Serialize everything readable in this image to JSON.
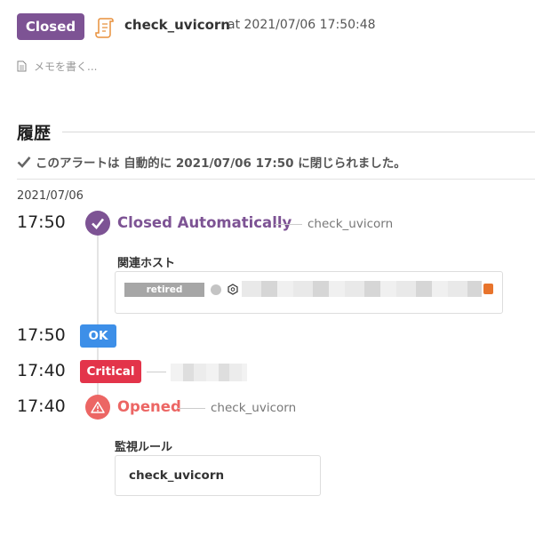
{
  "header": {
    "status": "Closed",
    "status_color": "#7d5394",
    "monitor_icon": "scroll-icon",
    "monitor_name": "check_uvicorn",
    "at_text": "at 2021/07/06 17:50:48"
  },
  "memo": {
    "icon": "document-icon",
    "placeholder": "メモを書く..."
  },
  "history": {
    "title": "履歴",
    "auto_closed_note": "このアラートは 自動的に 2021/07/06 17:50 に閉じられました。",
    "date": "2021/07/06",
    "events": [
      {
        "time": "17:50",
        "label": "Closed Automatically",
        "monitor": "check_uvicorn",
        "color": "#7d5394",
        "related_hosts_label": "関連ホスト",
        "host": {
          "tag": "retired",
          "status_color": "#c4c4c4"
        }
      },
      {
        "time": "17:50",
        "status": "OK",
        "color": "#3d8fe8"
      },
      {
        "time": "17:40",
        "status": "Critical",
        "color": "#e3344a"
      },
      {
        "time": "17:40",
        "label": "Opened",
        "monitor": "check_uvicorn",
        "color": "#ec6664",
        "rule_label": "監視ルール",
        "rule_name": "check_uvicorn"
      }
    ]
  }
}
